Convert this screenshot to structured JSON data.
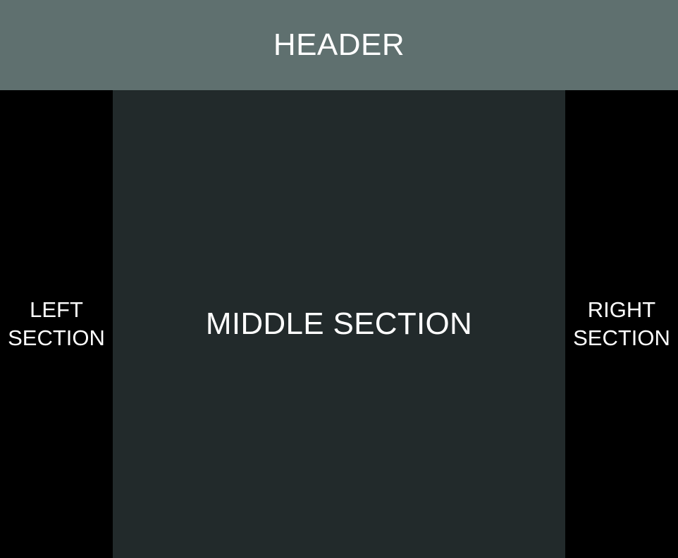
{
  "colors": {
    "header_bg": "#5f706f",
    "left_bg": "#000000",
    "middle_bg": "#222a2b",
    "right_bg": "#000000",
    "text": "#ffffff"
  },
  "header": {
    "label": "HEADER"
  },
  "left_section": {
    "line1": "LEFT",
    "line2": "SECTION"
  },
  "middle_section": {
    "label": "MIDDLE SECTION"
  },
  "right_section": {
    "line1": "RIGHT",
    "line2": "SECTION"
  }
}
